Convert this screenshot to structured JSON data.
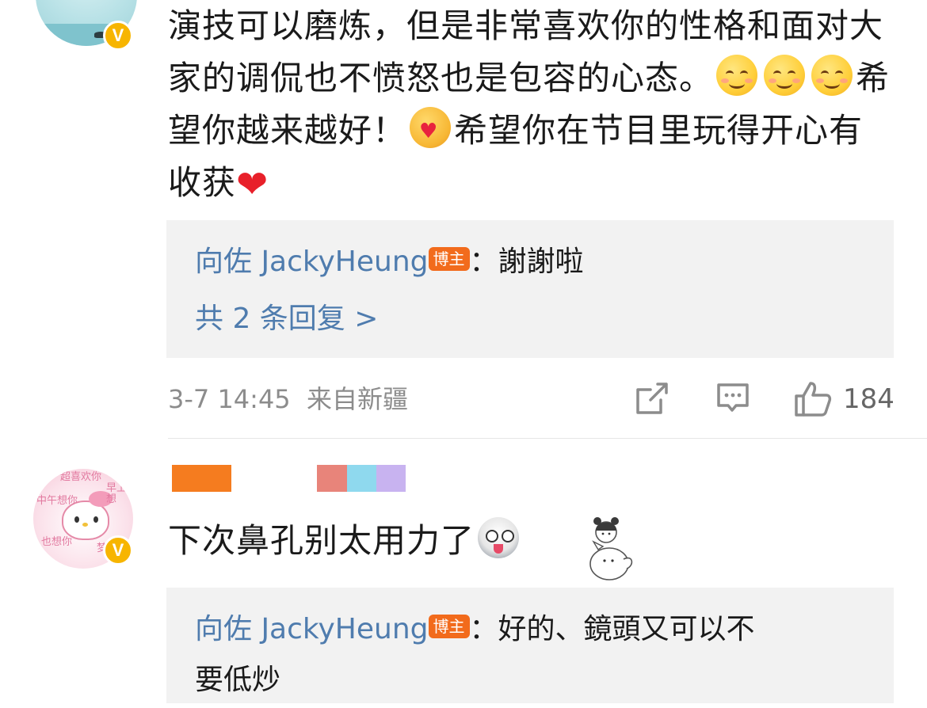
{
  "comment1": {
    "text_part1": "演技可以磨炼，但是非常喜欢你的性格和面对大家的调侃也不愤怒也是包容的心态。",
    "text_part2": "希望你越来越好！",
    "text_part3": "希望你在节目里玩得开心有收获",
    "reply": {
      "author": "向佐 JackyHeung",
      "badge": "博主",
      "text": "：謝謝啦"
    },
    "more_replies": "共 2 条回复 >",
    "timestamp": "3-7 14:45",
    "location": "来自新疆",
    "like_count": "184",
    "verified_badge": "V"
  },
  "comment2": {
    "text": "下次鼻孔别太用力了",
    "verified_badge": "V",
    "avatar_scribble": [
      "超喜欢你",
      "早上想",
      "中午想你",
      "也想你",
      "梦里"
    ],
    "username_colors": [
      "#f57c1f",
      "#e8847a",
      "#8fd9ee",
      "#c8b3f0"
    ],
    "reply": {
      "author": "向佐 JackyHeung",
      "badge": "博主",
      "text_line1": "：好的、鏡頭又可以不",
      "text_line2": "要低炒"
    }
  },
  "colors": {
    "link_blue": "#4f7cae",
    "badge_orange": "#f26b1c",
    "verified_yellow": "#f7b500",
    "meta_gray": "#8c8c8c"
  },
  "icons": [
    "share-icon",
    "comment-icon",
    "like-icon"
  ]
}
